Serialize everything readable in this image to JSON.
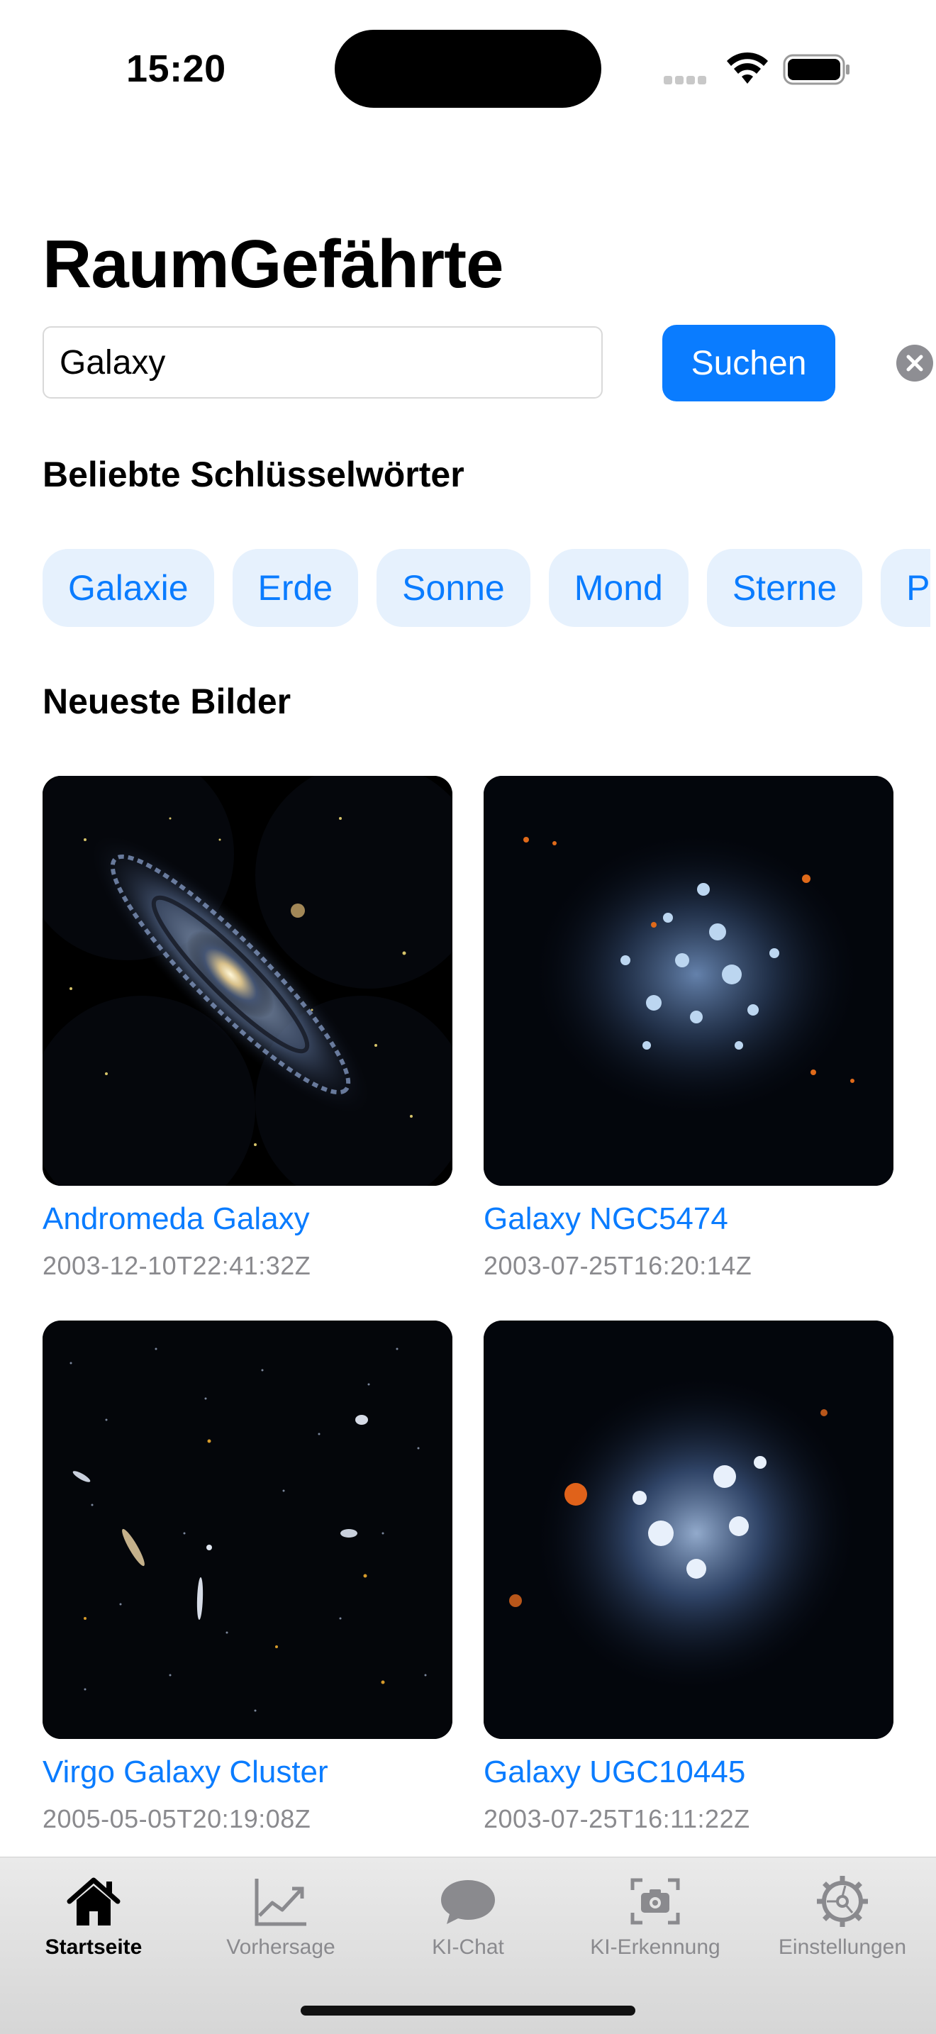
{
  "status_bar": {
    "time": "15:20"
  },
  "app": {
    "title": "RaumGefährte"
  },
  "search": {
    "value": "Galaxy",
    "button_label": "Suchen"
  },
  "sections": {
    "keywords_heading": "Beliebte Schlüsselwörter",
    "latest_heading": "Neueste Bilder"
  },
  "keywords": [
    "Galaxie",
    "Erde",
    "Sonne",
    "Mond",
    "Sterne",
    "Planeten"
  ],
  "images": [
    {
      "title": "Andromeda Galaxy",
      "date": "2003-12-10T22:41:32Z",
      "icon": "andromeda-galaxy-image"
    },
    {
      "title": "Galaxy NGC5474",
      "date": "2003-07-25T16:20:14Z",
      "icon": "ngc5474-galaxy-image"
    },
    {
      "title": "Virgo Galaxy Cluster",
      "date": "2005-05-05T20:19:08Z",
      "icon": "virgo-cluster-image"
    },
    {
      "title": "Galaxy UGC10445",
      "date": "2003-07-25T16:11:22Z",
      "icon": "ugc10445-galaxy-image"
    }
  ],
  "tabs": [
    {
      "label": "Startseite",
      "icon": "house-icon",
      "active": true
    },
    {
      "label": "Vorhersage",
      "icon": "chart-line-icon",
      "active": false
    },
    {
      "label": "KI-Chat",
      "icon": "chat-bubble-icon",
      "active": false
    },
    {
      "label": "KI-Erkennung",
      "icon": "camera-viewfinder-icon",
      "active": false
    },
    {
      "label": "Einstellungen",
      "icon": "gear-icon",
      "active": false
    }
  ],
  "colors": {
    "accent": "#0a7cff",
    "chip_bg": "#e6f1fd",
    "secondary_text": "#8a8a8e"
  }
}
